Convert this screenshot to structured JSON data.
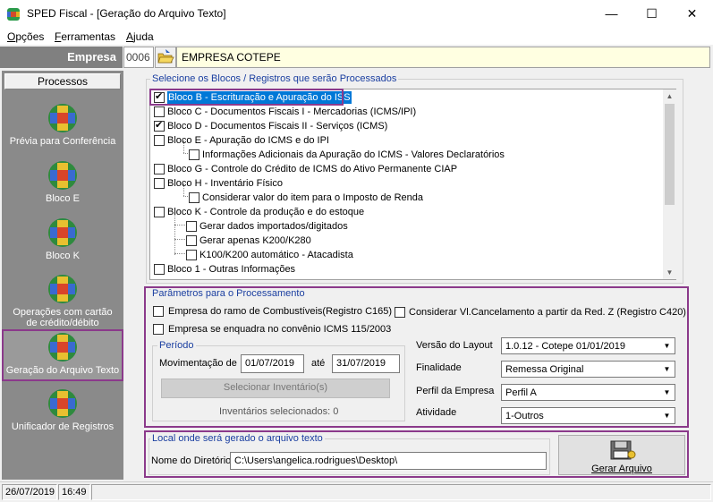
{
  "window": {
    "title": "SPED Fiscal - [Geração do Arquivo Texto]",
    "minimize": "—",
    "maximize": "☐",
    "close": "✕"
  },
  "menu": [
    {
      "label": "Opções",
      "underline": "O"
    },
    {
      "label": "Ferramentas",
      "underline": "F"
    },
    {
      "label": "Ajuda",
      "underline": "A"
    }
  ],
  "company": {
    "label": "Empresa",
    "code": "0006",
    "name": "EMPRESA COTEPE"
  },
  "sidebar": {
    "header": "Processos",
    "items": [
      {
        "label": "Prévia para Conferência",
        "selected": false
      },
      {
        "label": "Bloco E",
        "selected": false
      },
      {
        "label": "Bloco K",
        "selected": false
      },
      {
        "label": "Operações com cartão de crédito/débito",
        "selected": false
      },
      {
        "label": "Geração do Arquivo Texto",
        "selected": true
      },
      {
        "label": "Unificador de Registros",
        "selected": false
      }
    ]
  },
  "blocks": {
    "legend": "Selecione os Blocos / Registros que serão Processados",
    "items": [
      {
        "label": "Bloco B - Escrituração e Apuração do ISS",
        "checked": true,
        "level": 0,
        "selected": true
      },
      {
        "label": "Bloco C - Documentos Fiscais I - Mercadorias (ICMS/IPI)",
        "checked": false,
        "level": 0
      },
      {
        "label": "Bloco D - Documentos Fiscais II - Serviços (ICMS)",
        "checked": true,
        "level": 0
      },
      {
        "label": "Bloco E - Apuração do ICMS e do IPI",
        "checked": false,
        "level": 0
      },
      {
        "label": "Informações Adicionais da Apuração do ICMS - Valores Declaratórios",
        "checked": false,
        "level": 1
      },
      {
        "label": "Bloco G - Controle do Crédito de ICMS do Ativo Permanente CIAP",
        "checked": false,
        "level": 0
      },
      {
        "label": "Bloco H - Inventário Físico",
        "checked": false,
        "level": 0
      },
      {
        "label": "Considerar valor do item para o Imposto de Renda",
        "checked": false,
        "level": 1
      },
      {
        "label": "Bloco K - Controle da produção e do estoque",
        "checked": false,
        "level": 0
      },
      {
        "label": "Gerar dados importados/digitados",
        "checked": false,
        "level": 1
      },
      {
        "label": "Gerar apenas K200/K280",
        "checked": false,
        "level": 1
      },
      {
        "label": "K100/K200 automático - Atacadista",
        "checked": false,
        "level": 1
      },
      {
        "label": "Bloco 1 - Outras Informações",
        "checked": false,
        "level": 0
      }
    ]
  },
  "params": {
    "legend": "Parâmetros para o Processamento",
    "fuel": {
      "label": "Empresa do ramo de Combustíveis(Registro C165)",
      "checked": false
    },
    "cancel": {
      "label": "Considerar Vl.Cancelamento a partir da Red. Z (Registro C420)",
      "checked": false
    },
    "icms115": {
      "label": "Empresa se enquadra no convênio ICMS 115/2003",
      "checked": false
    },
    "period": {
      "legend": "Período",
      "movement_label": "Movimentação de",
      "from": "01/07/2019",
      "to_label": "até",
      "to": "31/07/2019",
      "inventory_button": "Selecionar Inventário(s)",
      "inventory_count": "Inventários selecionados: 0"
    },
    "layout_label": "Versão do Layout",
    "layout_value": "1.0.12 - Cotepe 01/01/2019",
    "purpose_label": "Finalidade",
    "purpose_value": "Remessa Original",
    "profile_label": "Perfil da Empresa",
    "profile_value": "Perfil A",
    "activity_label": "Atividade",
    "activity_value": "1-Outros"
  },
  "output": {
    "legend": "Local onde será gerado o arquivo texto",
    "dir_label": "Nome do Diretório",
    "dir_value": "C:\\Users\\angelica.rodrigues\\Desktop\\",
    "generate_button": "Gerar Arquivo"
  },
  "status": {
    "date": "26/07/2019",
    "time": "16:49"
  },
  "colors": {
    "accent_purple": "#8b3a8b",
    "legend_blue": "#1a3ea0",
    "sidebar_gray": "#8a8a8a",
    "selection_blue": "#0078d7"
  }
}
